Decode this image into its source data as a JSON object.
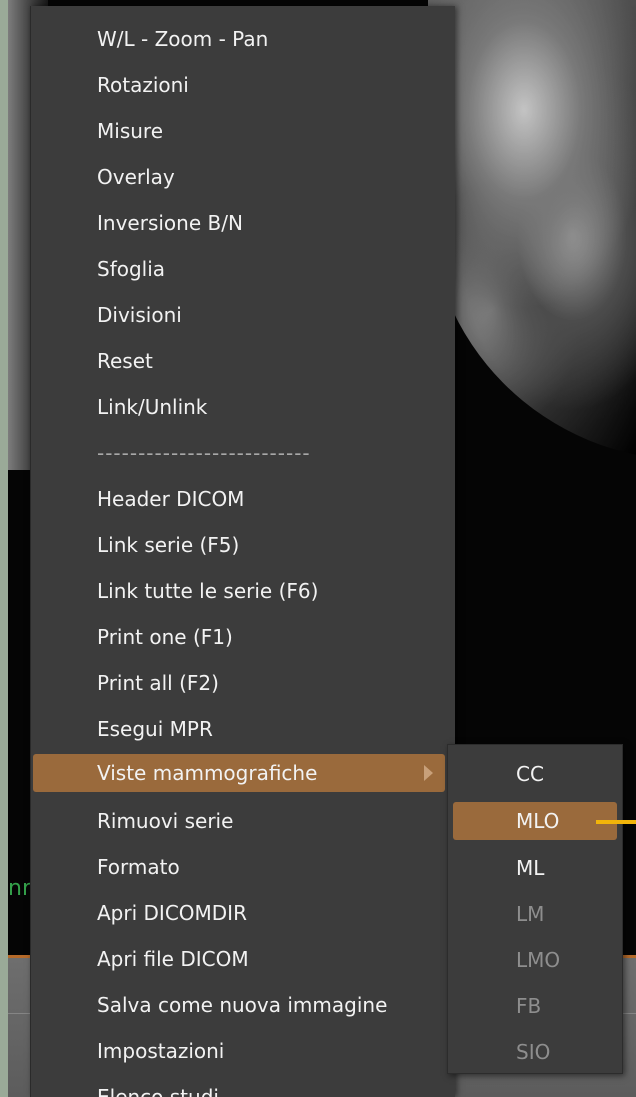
{
  "viewer": {
    "label_fragment": "nr"
  },
  "menu": {
    "items": [
      {
        "label": "W/L - Zoom - Pan"
      },
      {
        "label": "Rotazioni"
      },
      {
        "label": "Misure"
      },
      {
        "label": "Overlay"
      },
      {
        "label": "Inversione B/N"
      },
      {
        "label": "Sfoglia"
      },
      {
        "label": "Divisioni"
      },
      {
        "label": "Reset"
      },
      {
        "label": "Link/Unlink"
      },
      {
        "label": "--------------------------",
        "separator": true
      },
      {
        "label": "Header DICOM"
      },
      {
        "label": "Link serie (F5)"
      },
      {
        "label": "Link tutte le serie (F6)"
      },
      {
        "label": "Print one (F1)"
      },
      {
        "label": "Print all (F2)"
      },
      {
        "label": "Esegui MPR"
      },
      {
        "label": "Viste mammografiche",
        "active": true,
        "has_submenu": true
      },
      {
        "label": "Rimuovi serie"
      },
      {
        "label": "Formato"
      },
      {
        "label": "Apri DICOMDIR"
      },
      {
        "label": "Apri file DICOM"
      },
      {
        "label": "Salva come nuova immagine"
      },
      {
        "label": "Impostazioni"
      },
      {
        "label": "Elenco studi"
      }
    ]
  },
  "submenu": {
    "items": [
      {
        "label": "CC",
        "enabled": true
      },
      {
        "label": "MLO",
        "enabled": true,
        "active": true
      },
      {
        "label": "ML",
        "enabled": true
      },
      {
        "label": "LM",
        "enabled": false
      },
      {
        "label": "LMO",
        "enabled": false
      },
      {
        "label": "FB",
        "enabled": false
      },
      {
        "label": "SIO",
        "enabled": false
      }
    ]
  },
  "colors": {
    "menu_bg": "#3c3c3c",
    "highlight": "#9a6a3c",
    "pointer": "#f2b40a",
    "accent_line": "#b56a2a"
  }
}
